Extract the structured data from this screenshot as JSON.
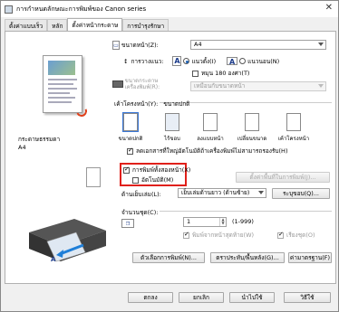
{
  "window": {
    "title": "การกำหนดลักษณะการพิมพ์ของ Canon                series",
    "close": "✕"
  },
  "tabs": [
    "ตั้งค่าแบบเร็ว",
    "หลัก",
    "ตั้งค่าหน้ากระดาษ",
    "การบำรุงรักษา"
  ],
  "preview": {
    "media_label": "กระดาษธรรมดา",
    "media_value": "A4"
  },
  "page_setup": {
    "page_size_label": "ขนาดหน้า(Z):",
    "page_size_value": "A4",
    "orientation_label": "การวางแนว:",
    "portrait_label": "แนวตั้ง(I)",
    "landscape_label": "แนวนอน(N)",
    "rotate_label": "หมุน 180 องศา(T)",
    "printer_paper_size_label": "ขนาดกระดาษเครื่องพิมพ์(R):",
    "printer_paper_size_value": "เหมือนกับขนาดหน้า"
  },
  "layout": {
    "label": "เค้าโครงหน้า(Y):",
    "value": "ขนาดปกติ",
    "options": [
      "ขนาดปกติ",
      "ไร้ขอบ",
      "ลงแบบหน้า",
      "เปลี่ยนขนาด",
      "เค้าโครงหน้า"
    ]
  },
  "auto_reduce": "ลดเอกสารที่ใหญ่อัตโนมัติถ้าเครื่องพิมพ์ไม่สามารถรองรับ(H)",
  "duplex": {
    "label": "การพิมพ์ทั้งสองหน้า(X)",
    "auto_label": "อัตโนมัติ(M)",
    "settings_button": "ตั้งค่าพื้นที่ในการพิมพ์(J)..."
  },
  "stapling": {
    "label": "ด้านเย็บเล่ม(L):",
    "value": "เย็บเล่มด้านยาว (ด้านซ้าย)",
    "margin_button": "ระบุขอบ(Q)..."
  },
  "copies": {
    "label": "จำนวนชุด(C):",
    "value": "1",
    "range": "(1-999)",
    "last_page_first": "พิมพ์จากหน้าสุดท้าย(W)",
    "collate": "เรียงชุด(O)"
  },
  "footer_buttons": {
    "print_options": "ตัวเลือกการพิมพ์(N)...",
    "stamp_background": "ตราประทับ/พื้นหลัง(G)...",
    "defaults": "ค่ามาตรฐาน(F)"
  },
  "dialog_buttons": {
    "ok": "ตกลง",
    "cancel": "ยกเลิก",
    "apply": "นำไปใช้",
    "help": "วิธีใช้"
  },
  "colors": {
    "highlight": "#e0201a",
    "accent": "#3a78d8"
  }
}
